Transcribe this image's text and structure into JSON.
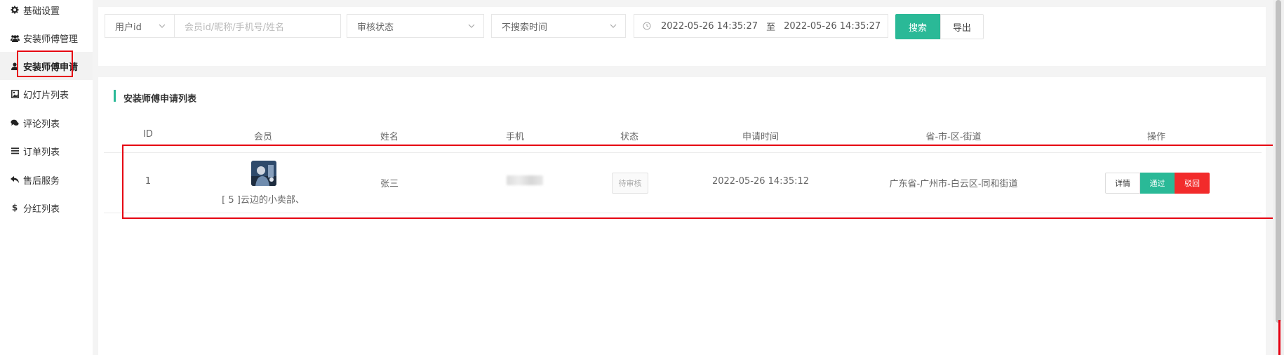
{
  "sidebar": {
    "items": [
      {
        "label": "基础设置",
        "icon": "gear-icon"
      },
      {
        "label": "安装师傅管理",
        "icon": "users-icon"
      },
      {
        "label": "安装师傅申请",
        "icon": "user-icon"
      },
      {
        "label": "幻灯片列表",
        "icon": "image-icon"
      },
      {
        "label": "评论列表",
        "icon": "comments-icon"
      },
      {
        "label": "订单列表",
        "icon": "list-icon"
      },
      {
        "label": "售后服务",
        "icon": "reply-icon"
      },
      {
        "label": "分红列表",
        "icon": "dollar-icon"
      }
    ],
    "active_index": 2
  },
  "search": {
    "field_select": "用户id",
    "keyword_placeholder": "会员id/昵称/手机号/姓名",
    "status_select": "审核状态",
    "time_select": "不搜索时间",
    "date_start": "2022-05-26 14:35:27",
    "date_sep": "至",
    "date_end": "2022-05-26 14:35:27",
    "search_label": "搜索",
    "export_label": "导出"
  },
  "list": {
    "title": "安装师傅申请列表",
    "columns": [
      "ID",
      "会员",
      "姓名",
      "手机",
      "状态",
      "申请时间",
      "省-市-区-街道",
      "操作"
    ],
    "rows": [
      {
        "id": "1",
        "member": "[ 5 ]云边的小卖部、",
        "name": "张三",
        "phone": "",
        "status": "待审核",
        "apply_time": "2022-05-26 14:35:12",
        "address": "广东省-广州市-白云区-同和街道",
        "actions": {
          "detail": "详情",
          "pass": "通过",
          "reject": "驳回"
        }
      }
    ]
  },
  "colors": {
    "accent": "#2ab997",
    "danger": "#f22b2b",
    "annotation": "#e60012"
  }
}
